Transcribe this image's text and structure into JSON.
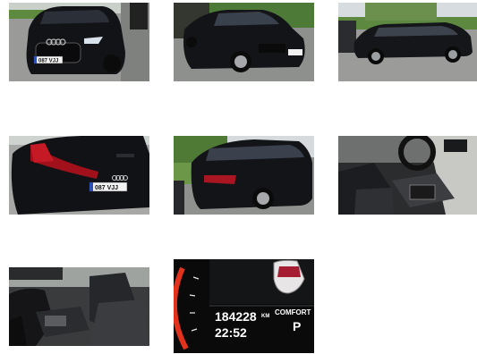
{
  "gallery": {
    "items": [
      {
        "alt": "front-view",
        "plate": "087 VJJ"
      },
      {
        "alt": "front-side-view"
      },
      {
        "alt": "side-view"
      },
      {
        "alt": "rear-view",
        "plate": "087 VJJ"
      },
      {
        "alt": "rear-side-view"
      },
      {
        "alt": "interior-center-console"
      },
      {
        "alt": "interior-front-seats"
      },
      {
        "alt": "instrument-cluster"
      }
    ]
  },
  "dashboard": {
    "odometer": "184228",
    "odometer_unit": "KM",
    "clock": "22:52",
    "drive_mode": "COMFORT",
    "gear": "P"
  },
  "colors": {
    "car_body": "#15161a",
    "asphalt": "#8d8f8c",
    "grass": "#5f8a3e",
    "taillight": "#b3121b",
    "dash_red": "#e0321c"
  }
}
